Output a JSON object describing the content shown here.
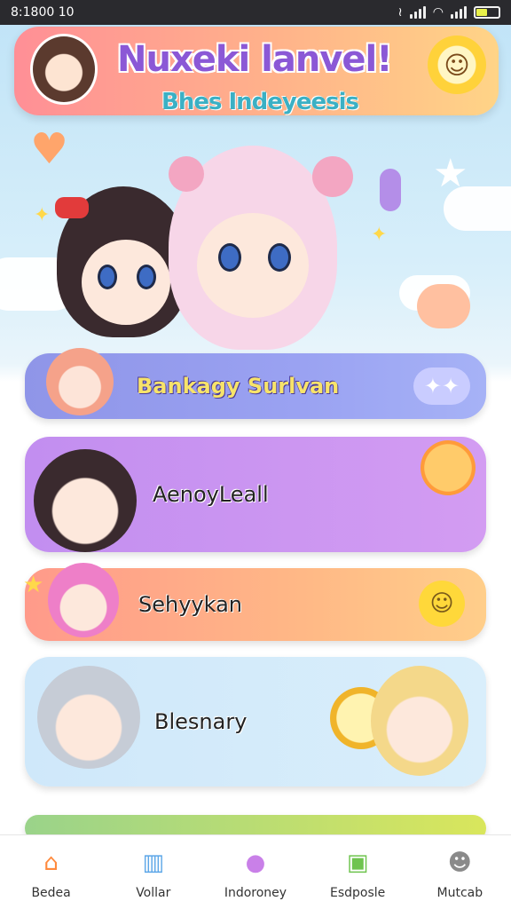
{
  "status_bar": {
    "time": "8:1800 10"
  },
  "header": {
    "title": "Nuxeki lanvel!",
    "subtitle": "Bhes Indeyeesis"
  },
  "cards": [
    {
      "label": "Bankagy Surlvan"
    },
    {
      "label": "AenoyLeall"
    },
    {
      "label": "Sehyykan"
    },
    {
      "label": "Blesnary"
    }
  ],
  "nav": [
    {
      "label": "Bedea",
      "icon": "home-icon",
      "color": "#ff8a3d"
    },
    {
      "label": "Vollar",
      "icon": "house-icon",
      "color": "#5da7e8"
    },
    {
      "label": "Indoroney",
      "icon": "pet-icon",
      "color": "#c980e8"
    },
    {
      "label": "Esdposle",
      "icon": "gallery-icon",
      "color": "#6fc44f"
    },
    {
      "label": "Mutcab",
      "icon": "profile-icon",
      "color": "#8a8a8a"
    }
  ]
}
